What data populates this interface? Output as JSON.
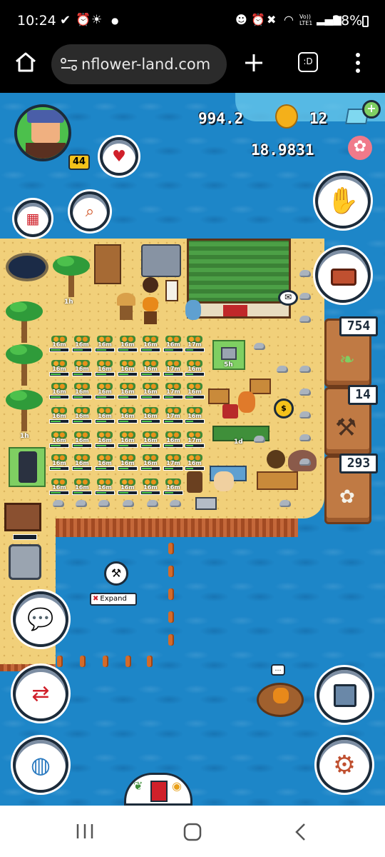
{
  "status_bar": {
    "time": "10:24",
    "left_icons": [
      "check-icon",
      "alarm-icon",
      "brightness-icon",
      "dot-icon"
    ],
    "right_icons": [
      "face-icon",
      "alarm-icon",
      "mute-icon",
      "wifi-icon",
      "volte-icon",
      "signal-icon"
    ],
    "volte_text": "Vo)) LTE1",
    "battery": "28%"
  },
  "browser": {
    "url": "nflower-land.com",
    "tab_label": ":D"
  },
  "hud": {
    "coins": "994.2",
    "gems": "12",
    "flower": "18.9831",
    "level": "44"
  },
  "side": {
    "item1": "754",
    "item2": "14",
    "item3": "293"
  },
  "timers": {
    "rows": [
      [
        "16m",
        "16m",
        "16m",
        "16m",
        "16m",
        "16m",
        "17m"
      ],
      [
        "16m",
        "16m",
        "16m",
        "16m",
        "16m",
        "17m",
        "16m"
      ],
      [
        "16m",
        "16m",
        "16m",
        "16m",
        "16m",
        "17m",
        "16m"
      ],
      [
        "16m",
        "16m",
        "16m",
        "16m",
        "16m",
        "17m",
        "16m"
      ],
      [
        "16m",
        "16m",
        "16m",
        "16m",
        "16m",
        "16m",
        "17m"
      ],
      [
        "16m",
        "16m",
        "16m",
        "16m",
        "16m",
        "17m",
        "16m"
      ],
      [
        "16m",
        "16m",
        "16m",
        "16m",
        "16m",
        "16m"
      ]
    ],
    "top_tree": "1h",
    "left_tree": "1h",
    "well": "5h",
    "garden": "1d"
  },
  "expand_label": "Expand",
  "colors": {
    "sea": "#1d86c8",
    "sand": "#f1d07a",
    "cliff": "#b95a2c",
    "ui_border": "#1c2b3a"
  }
}
